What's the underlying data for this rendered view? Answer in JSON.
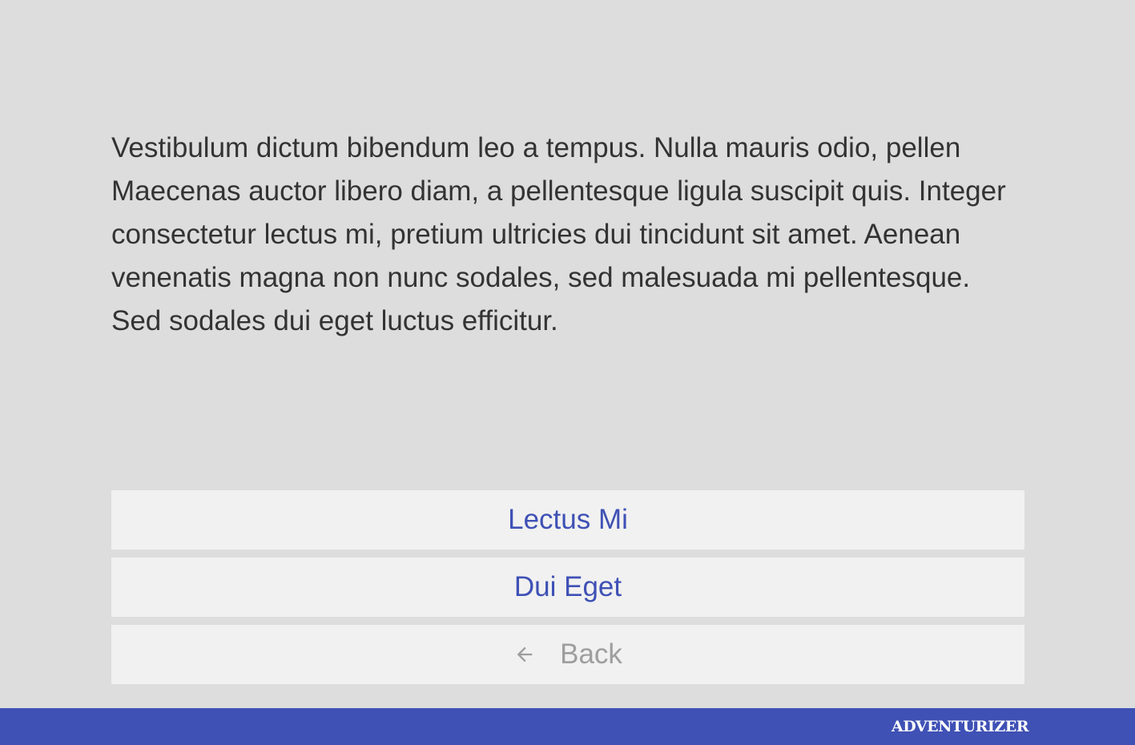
{
  "story": {
    "text": "Vestibulum dictum bibendum leo a tempus. Nulla mauris odio, pellen Maecenas auctor libero diam, a pellentesque ligula suscipit quis. Integer consectetur lectus mi, pretium ultricies dui tincidunt sit amet. Aenean venenatis magna non nunc sodales, sed malesuada mi pellentesque. Sed sodales dui eget luctus efficitur."
  },
  "choices": [
    {
      "label": "Lectus Mi"
    },
    {
      "label": "Dui Eget"
    }
  ],
  "back": {
    "label": "Back",
    "icon": "arrow-left-icon"
  },
  "footer": {
    "logo": "ADVENTURIZER"
  },
  "colors": {
    "background": "#dddddd",
    "button_background": "#f1f1f1",
    "accent": "#3f51b5",
    "text": "#333333",
    "back_text": "#9e9e9e",
    "footer_background": "#3f51b5"
  }
}
